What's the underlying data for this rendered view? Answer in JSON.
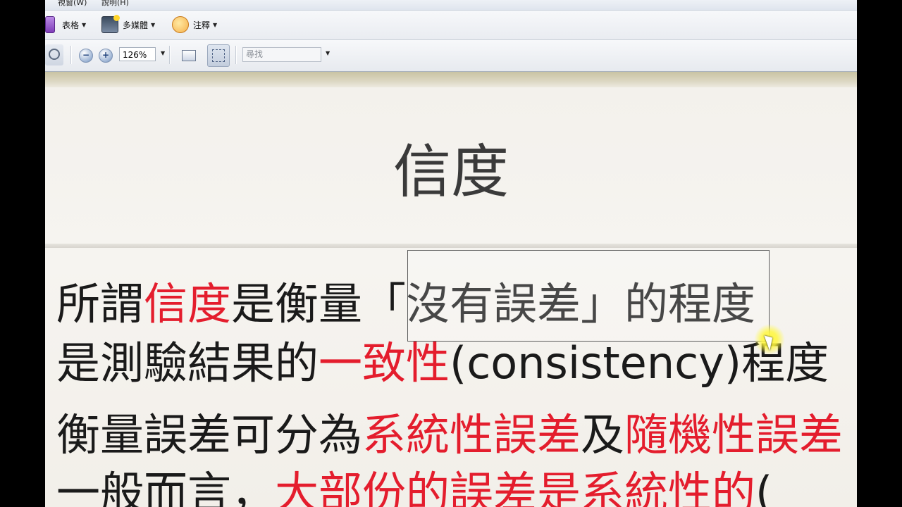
{
  "menu": {
    "items": [
      {
        "label": "視窗(W)"
      },
      {
        "label": "說明(H)"
      }
    ]
  },
  "toolbar1": {
    "table": {
      "label": "表格",
      "icon": "table-icon"
    },
    "multimedia": {
      "label": "多媒體",
      "icon": "multimedia-icon"
    },
    "comments": {
      "label": "注釋",
      "icon": "comment-bubble-icon"
    }
  },
  "toolbar2": {
    "zoom_value": "126%",
    "find_placeholder": "尋找",
    "icons": [
      "zoom-tool-icon",
      "zoom-out-icon",
      "zoom-in-icon",
      "fit-width-icon",
      "fit-page-icon"
    ]
  },
  "slide": {
    "title": "信度",
    "lines": [
      {
        "segments": [
          {
            "text": "所謂",
            "red": false
          },
          {
            "text": "信度",
            "red": true
          },
          {
            "text": "是衡量「沒有誤差」的程度",
            "red": false
          }
        ]
      },
      {
        "segments": [
          {
            "text": "是測驗結果的",
            "red": false
          },
          {
            "text": "一致性",
            "red": true
          },
          {
            "text": "(consistency)程度",
            "red": false
          }
        ]
      },
      {
        "segments": [
          {
            "text": "衡量誤差可分為",
            "red": false
          },
          {
            "text": "系統性誤差",
            "red": true
          },
          {
            "text": "及",
            "red": false
          },
          {
            "text": "隨機性誤差",
            "red": true
          }
        ]
      },
      {
        "segments": [
          {
            "text": "一般而言，",
            "red": false
          },
          {
            "text": "大部份的誤差是系統性的",
            "red": true
          },
          {
            "text": "(",
            "red": false
          }
        ]
      }
    ]
  },
  "colors": {
    "accent_red": "#e41d2d",
    "highlight_cursor": "#fff73e"
  }
}
